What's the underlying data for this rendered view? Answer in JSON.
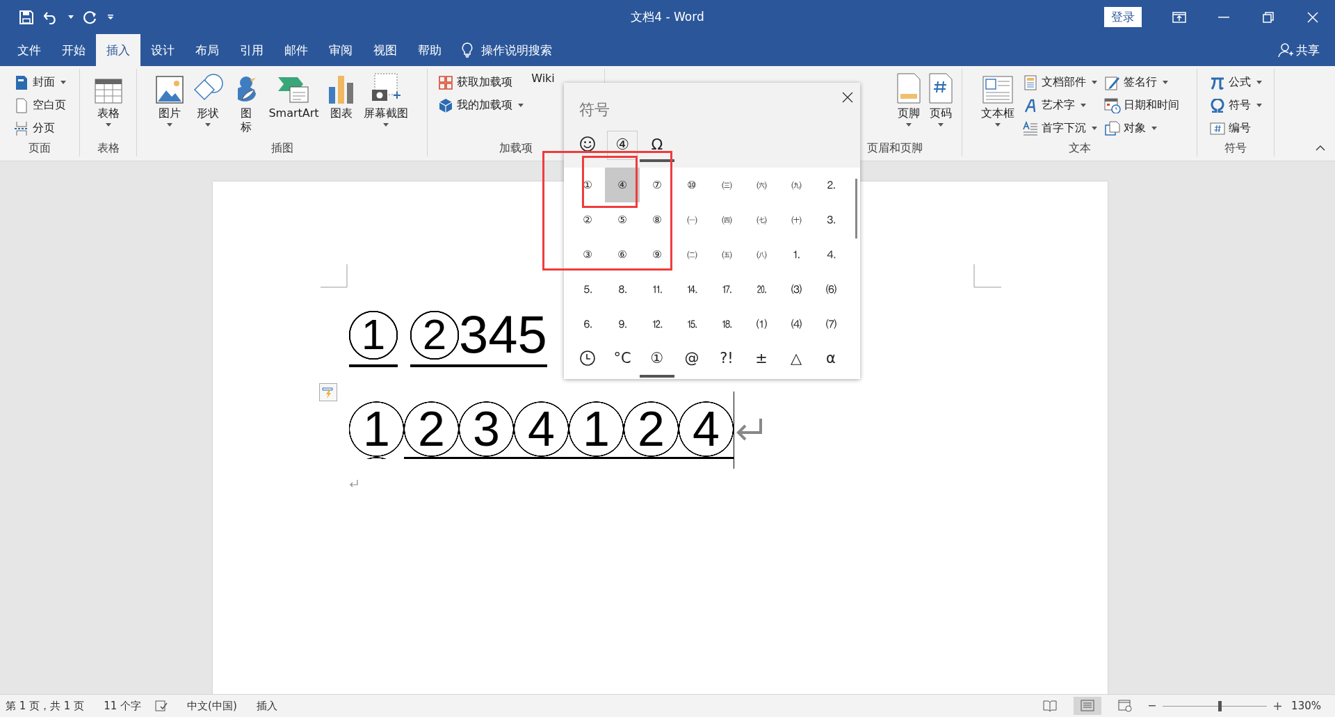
{
  "title_bar": {
    "title": "文档4 - Word",
    "sign_in": "登录"
  },
  "menu_tabs": [
    {
      "label": "文件",
      "selected": false
    },
    {
      "label": "开始",
      "selected": false
    },
    {
      "label": "插入",
      "selected": true
    },
    {
      "label": "设计",
      "selected": false
    },
    {
      "label": "布局",
      "selected": false
    },
    {
      "label": "引用",
      "selected": false
    },
    {
      "label": "邮件",
      "selected": false
    },
    {
      "label": "审阅",
      "selected": false
    },
    {
      "label": "视图",
      "selected": false
    },
    {
      "label": "帮助",
      "selected": false
    }
  ],
  "tell_me": "操作说明搜索",
  "share": "共享",
  "ribbon": {
    "groups": [
      {
        "label": "页面",
        "columns": [
          {
            "kind": "stack",
            "items": [
              {
                "label": "封面",
                "dropdown": true
              },
              {
                "label": "空白页",
                "dropdown": false
              },
              {
                "label": "分页",
                "dropdown": false
              }
            ]
          }
        ]
      },
      {
        "label": "表格",
        "columns": [
          {
            "kind": "large",
            "items": [
              {
                "label": "表格",
                "dropdown": true
              }
            ]
          }
        ]
      },
      {
        "label": "插图",
        "columns": [
          {
            "kind": "large",
            "items": [
              {
                "label": "图片",
                "dropdown": true
              }
            ]
          },
          {
            "kind": "large",
            "items": [
              {
                "label": "形状",
                "dropdown": true
              }
            ]
          },
          {
            "kind": "large",
            "items": [
              {
                "label": "图标",
                "dropdown": false
              }
            ]
          },
          {
            "kind": "large",
            "items": [
              {
                "label": "SmartArt",
                "dropdown": false
              }
            ]
          },
          {
            "kind": "large",
            "items": [
              {
                "label": "图表",
                "dropdown": false
              }
            ]
          },
          {
            "kind": "large",
            "items": [
              {
                "label": "屏幕截图",
                "dropdown": true
              }
            ]
          }
        ]
      },
      {
        "label": "加载项",
        "columns": [
          {
            "kind": "stack",
            "items": [
              {
                "label": "获取加载项",
                "dropdown": false
              },
              {
                "label": "我的加载项",
                "dropdown": true
              }
            ]
          },
          {
            "kind": "large",
            "items": [
              {
                "label": "Wiki",
                "dropdown": false
              }
            ]
          }
        ]
      },
      {
        "label": "页眉和页脚",
        "columns": [
          {
            "kind": "large",
            "items": [
              {
                "label": "页脚",
                "dropdown": true
              }
            ]
          },
          {
            "kind": "large",
            "items": [
              {
                "label": "页码",
                "dropdown": true
              }
            ]
          }
        ]
      },
      {
        "label": "文本",
        "columns": [
          {
            "kind": "large",
            "items": [
              {
                "label": "文本框",
                "dropdown": true
              }
            ]
          },
          {
            "kind": "stack",
            "items": [
              {
                "label": "文档部件",
                "dropdown": true
              },
              {
                "label": "艺术字",
                "dropdown": true
              },
              {
                "label": "首字下沉",
                "dropdown": true
              }
            ]
          },
          {
            "kind": "stack",
            "items": [
              {
                "label": "签名行",
                "dropdown": true
              },
              {
                "label": "日期和时间",
                "dropdown": false
              },
              {
                "label": "对象",
                "dropdown": true
              }
            ]
          }
        ]
      },
      {
        "label": "符号",
        "columns": [
          {
            "kind": "stack",
            "items": [
              {
                "label": "公式",
                "dropdown": true
              },
              {
                "label": "符号",
                "dropdown": true
              },
              {
                "label": "编号",
                "dropdown": false
              }
            ]
          }
        ]
      }
    ]
  },
  "document": {
    "line1": [
      {
        "char": "1",
        "circled": true,
        "underlined": true
      },
      {
        "char": "2",
        "circled": true,
        "underlined": true
      },
      {
        "char": "3",
        "circled": false,
        "underlined": true
      },
      {
        "char": "4",
        "circled": false,
        "underlined": true
      },
      {
        "char": "5",
        "circled": false,
        "underlined": true
      }
    ],
    "line2": [
      {
        "char": "1",
        "circled": true,
        "underlined": false
      },
      {
        "char": "2",
        "circled": true,
        "underlined": true
      },
      {
        "char": "3",
        "circled": true,
        "underlined": true
      },
      {
        "char": "4",
        "circled": true,
        "underlined": true
      },
      {
        "char": "1",
        "circled": true,
        "underlined": true
      },
      {
        "char": "2",
        "circled": true,
        "underlined": true
      },
      {
        "char": "4",
        "circled": true,
        "underlined": true
      }
    ]
  },
  "symbol_panel": {
    "title": "符号",
    "top_tabs": [
      {
        "kind": "smiley",
        "selected": false,
        "hovered": false
      },
      {
        "kind": "text",
        "label": "④",
        "selected": false,
        "hovered": true
      },
      {
        "kind": "text",
        "label": "Ω",
        "selected": true,
        "hovered": false
      }
    ],
    "symbols": [
      {
        "symbol": "①",
        "selected": false
      },
      {
        "symbol": "④",
        "selected": true
      },
      {
        "symbol": "⑦",
        "selected": false
      },
      {
        "symbol": "⑩",
        "selected": false
      },
      {
        "symbol": "㈢",
        "selected": false
      },
      {
        "symbol": "㈥",
        "selected": false
      },
      {
        "symbol": "㈨",
        "selected": false
      },
      {
        "symbol": "⒉",
        "selected": false
      },
      {
        "symbol": "②",
        "selected": false
      },
      {
        "symbol": "⑤",
        "selected": false
      },
      {
        "symbol": "⑧",
        "selected": false
      },
      {
        "symbol": "㈠",
        "selected": false
      },
      {
        "symbol": "㈣",
        "selected": false
      },
      {
        "symbol": "㈦",
        "selected": false
      },
      {
        "symbol": "㈩",
        "selected": false
      },
      {
        "symbol": "⒊",
        "selected": false
      },
      {
        "symbol": "③",
        "selected": false
      },
      {
        "symbol": "⑥",
        "selected": false
      },
      {
        "symbol": "⑨",
        "selected": false
      },
      {
        "symbol": "㈡",
        "selected": false
      },
      {
        "symbol": "㈤",
        "selected": false
      },
      {
        "symbol": "㈧",
        "selected": false
      },
      {
        "symbol": "⒈",
        "selected": false
      },
      {
        "symbol": "⒋",
        "selected": false
      },
      {
        "symbol": "⒌",
        "selected": false
      },
      {
        "symbol": "⒏",
        "selected": false
      },
      {
        "symbol": "⒒",
        "selected": false
      },
      {
        "symbol": "⒕",
        "selected": false
      },
      {
        "symbol": "⒘",
        "selected": false
      },
      {
        "symbol": "⒛",
        "selected": false
      },
      {
        "symbol": "⑶",
        "selected": false
      },
      {
        "symbol": "⑹",
        "selected": false
      },
      {
        "symbol": "⒍",
        "selected": false
      },
      {
        "symbol": "⒐",
        "selected": false
      },
      {
        "symbol": "⒓",
        "selected": false
      },
      {
        "symbol": "⒖",
        "selected": false
      },
      {
        "symbol": "⒙",
        "selected": false
      },
      {
        "symbol": "⑴",
        "selected": false
      },
      {
        "symbol": "⑷",
        "selected": false
      },
      {
        "symbol": "⑺",
        "selected": false
      }
    ],
    "bottom_tabs": [
      {
        "kind": "clock",
        "selected": false
      },
      {
        "kind": "text",
        "label": "°C",
        "selected": false
      },
      {
        "kind": "text",
        "label": "①",
        "selected": true
      },
      {
        "kind": "text",
        "label": "@",
        "selected": false
      },
      {
        "kind": "text",
        "label": "?!",
        "selected": false
      },
      {
        "kind": "text",
        "label": "±",
        "selected": false
      },
      {
        "kind": "text",
        "label": "△",
        "selected": false
      },
      {
        "kind": "text",
        "label": "α",
        "selected": false
      }
    ]
  },
  "status_bar": {
    "page": "第 1 页，共 1 页",
    "words": "11 个字",
    "language": "中文(中国)",
    "mode": "插入",
    "views": [
      {
        "kind": "read",
        "selected": false
      },
      {
        "kind": "print",
        "selected": true
      },
      {
        "kind": "web",
        "selected": false
      }
    ],
    "zoom": {
      "level": 0.53,
      "reading": "130%"
    }
  }
}
